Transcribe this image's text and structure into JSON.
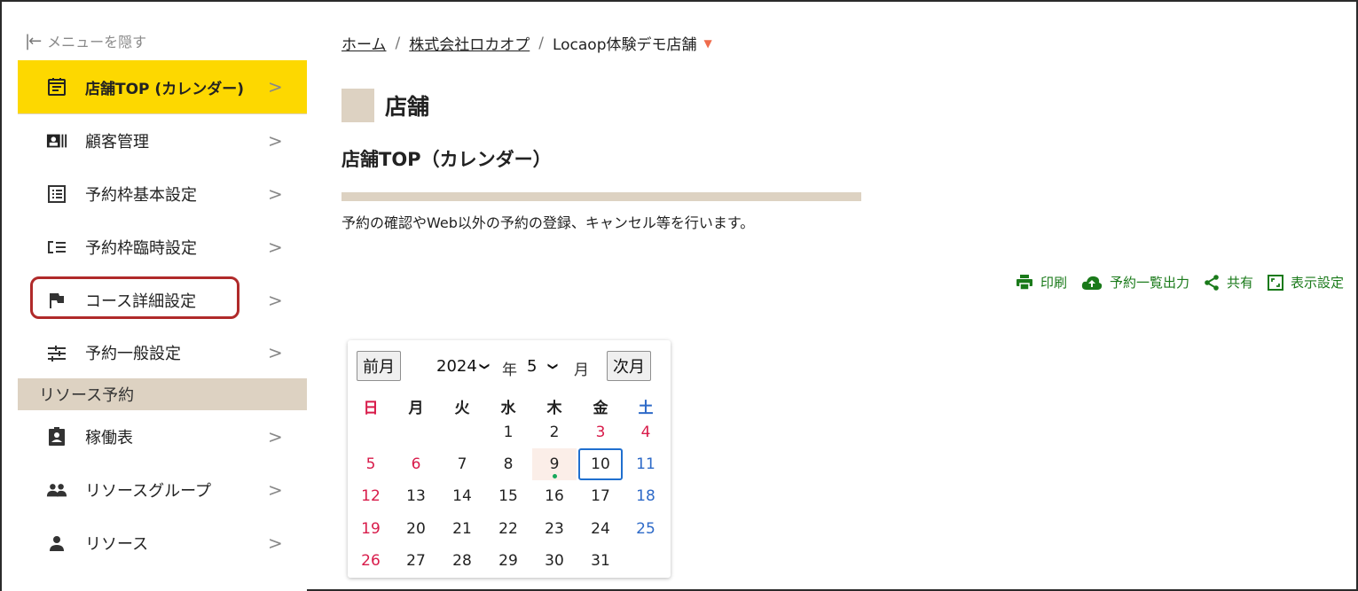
{
  "sidebar": {
    "hide_menu_label": "メニューを隠す",
    "items": [
      {
        "label": "店舗TOP (カレンダー)",
        "icon": "calendar-icon",
        "active": true
      },
      {
        "label": "顧客管理",
        "icon": "contact-card-icon"
      },
      {
        "label": "予約枠基本設定",
        "icon": "list-icon"
      },
      {
        "label": "予約枠臨時設定",
        "icon": "add-list-icon"
      },
      {
        "label": "コース詳細設定",
        "icon": "flag-icon"
      },
      {
        "label": "予約一般設定",
        "icon": "sliders-icon"
      }
    ],
    "section_label": "リソース予約",
    "resource_items": [
      {
        "label": "稼働表",
        "icon": "badge-icon"
      },
      {
        "label": "リソースグループ",
        "icon": "group-icon"
      },
      {
        "label": "リソース",
        "icon": "person-icon"
      }
    ],
    "chevron": ">"
  },
  "breadcrumb": {
    "home": "ホーム",
    "separator": "/",
    "company": "株式会社ロカオプ",
    "store": "Locaop体験デモ店舗"
  },
  "page": {
    "title": "店舗",
    "subtitle": "店舗TOP（カレンダー）",
    "description": "予約の確認やWeb以外の予約の登録、キャンセル等を行います。"
  },
  "toolbar": {
    "print": "印刷",
    "export": "予約一覧出力",
    "share": "共有",
    "display_settings": "表示設定"
  },
  "calendar": {
    "prev_label": "前月",
    "next_label": "次月",
    "year": "2024",
    "year_unit": "年",
    "month": "5",
    "month_unit": "月",
    "weekdays": [
      "日",
      "月",
      "火",
      "水",
      "木",
      "金",
      "土"
    ],
    "weeks": [
      [
        "",
        "",
        "",
        "1",
        "2",
        "3",
        "4"
      ],
      [
        "5",
        "6",
        "7",
        "8",
        "9",
        "10",
        "11"
      ],
      [
        "12",
        "13",
        "14",
        "15",
        "16",
        "17",
        "18"
      ],
      [
        "19",
        "20",
        "21",
        "22",
        "23",
        "24",
        "25"
      ],
      [
        "26",
        "27",
        "28",
        "29",
        "30",
        "31",
        ""
      ]
    ],
    "holidays": [
      "3",
      "4",
      "6"
    ],
    "today": "9",
    "selected": "10"
  },
  "colors": {
    "accent_yellow": "#fdd800",
    "beige": "#ddd2c2",
    "toolbar_green": "#1a7a1a",
    "highlight_red": "#b02a2a",
    "sunday_red": "#d81b4a",
    "saturday_blue": "#2e6ac8"
  }
}
